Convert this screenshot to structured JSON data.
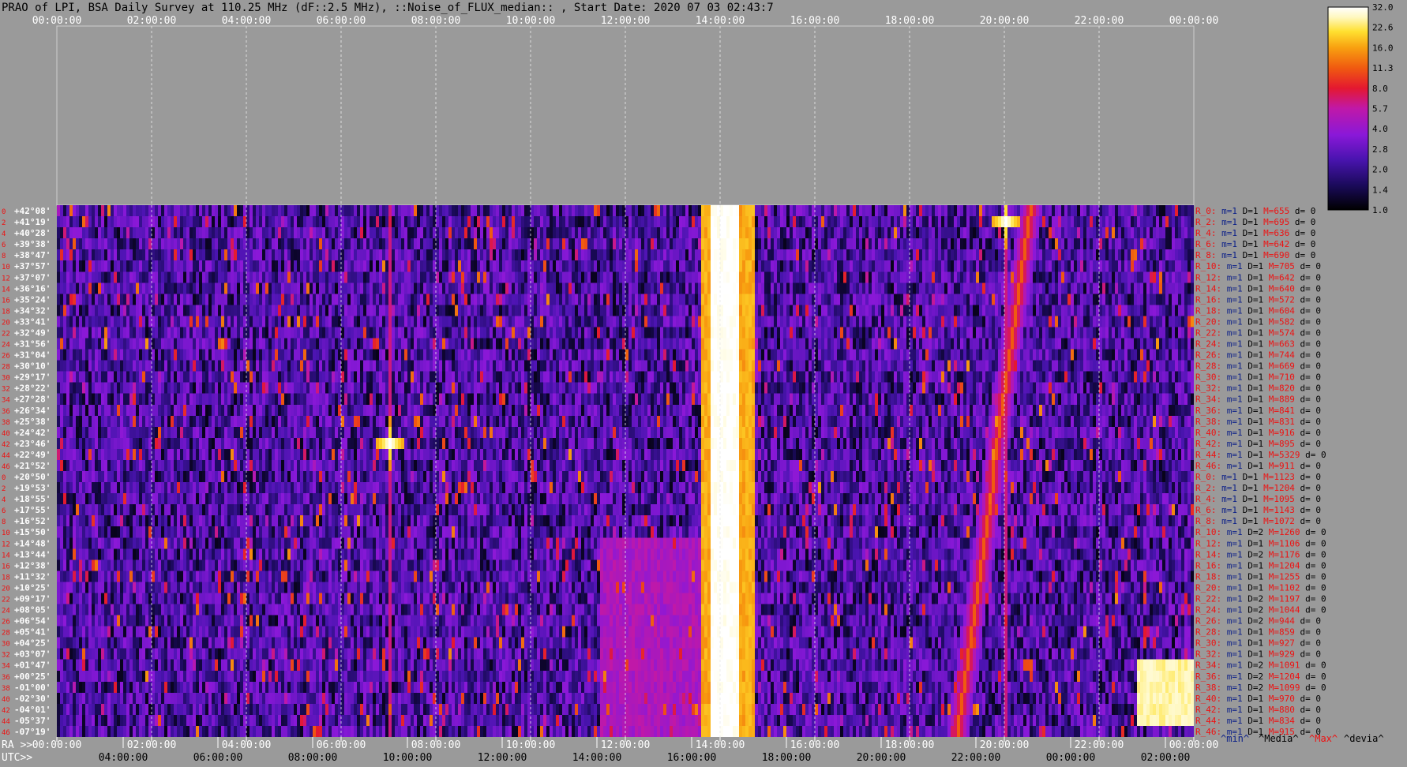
{
  "title": "PRAO of LPI, BSA Daily Survey at 110.25 MHz (dF::2.5 MHz), ::Noise_of_FLUX_median:: , Start Date: 2020 07 03 02:43:7",
  "top_axis_ticks": [
    "00:00:00",
    "02:00:00",
    "04:00:00",
    "06:00:00",
    "08:00:00",
    "10:00:00",
    "12:00:00",
    "14:00:00",
    "16:00:00",
    "18:00:00",
    "20:00:00",
    "22:00:00",
    "00:00:00"
  ],
  "bottom_axis": {
    "ra_label": "RA >>",
    "utc_label": "UTC>>",
    "ra_ticks": [
      "00:00:00",
      "02:00:00",
      "04:00:00",
      "06:00:00",
      "08:00:00",
      "10:00:00",
      "12:00:00",
      "14:00:00",
      "16:00:00",
      "18:00:00",
      "20:00:00",
      "22:00:00",
      "00:00:00"
    ],
    "utc_ticks": [
      "04:00:00",
      "06:00:00",
      "08:00:00",
      "10:00:00",
      "12:00:00",
      "14:00:00",
      "16:00:00",
      "18:00:00",
      "20:00:00",
      "22:00:00",
      "00:00:00",
      "02:00:00"
    ]
  },
  "row_indices": [
    "0",
    "2",
    "4",
    "6",
    "8",
    "10",
    "12",
    "14",
    "16",
    "18",
    "20",
    "22",
    "24",
    "26",
    "28",
    "30",
    "32",
    "34",
    "36",
    "38",
    "40",
    "42",
    "44",
    "46",
    "0",
    "2",
    "4",
    "6",
    "8",
    "10",
    "12",
    "14",
    "16",
    "18",
    "20",
    "22",
    "24",
    "26",
    "28",
    "30",
    "32",
    "34",
    "36",
    "38",
    "40",
    "42",
    "44",
    "46"
  ],
  "declinations": [
    "+42°08'",
    "+41°19'",
    "+40°28'",
    "+39°38'",
    "+38°47'",
    "+37°57'",
    "+37°07'",
    "+36°16'",
    "+35°24'",
    "+34°32'",
    "+33°41'",
    "+32°49'",
    "+31°56'",
    "+31°04'",
    "+30°10'",
    "+29°17'",
    "+28°22'",
    "+27°28'",
    "+26°34'",
    "+25°38'",
    "+24°42'",
    "+23°46'",
    "+22°49'",
    "+21°52'",
    "+20°50'",
    "+19°53'",
    "+18°55'",
    "+17°55'",
    "+16°52'",
    "+15°50'",
    "+14°48'",
    "+13°44'",
    "+12°38'",
    "+11°32'",
    "+10°25'",
    "+09°17'",
    "+08°05'",
    "+06°54'",
    "+05°41'",
    "+04°25'",
    "+03°07'",
    "+01°47'",
    "+00°25'",
    "-01°00'",
    "-02°30'",
    "-04°01'",
    "-05°37'",
    "-07°19'"
  ],
  "stats_rows": [
    {
      "r": "R_0:",
      "m": "m=1",
      "d": "D=1",
      "M": "M=655",
      "dev": "d= 0"
    },
    {
      "r": "R_2:",
      "m": "m=1",
      "d": "D=1",
      "M": "M=695",
      "dev": "d= 0"
    },
    {
      "r": "R_4:",
      "m": "m=1",
      "d": "D=1",
      "M": "M=636",
      "dev": "d= 0"
    },
    {
      "r": "R_6:",
      "m": "m=1",
      "d": "D=1",
      "M": "M=642",
      "dev": "d= 0"
    },
    {
      "r": "R_8:",
      "m": "m=1",
      "d": "D=1",
      "M": "M=690",
      "dev": "d= 0"
    },
    {
      "r": "R_10:",
      "m": "m=1",
      "d": "D=1",
      "M": "M=705",
      "dev": "d= 0"
    },
    {
      "r": "R_12:",
      "m": "m=1",
      "d": "D=1",
      "M": "M=642",
      "dev": "d= 0"
    },
    {
      "r": "R_14:",
      "m": "m=1",
      "d": "D=1",
      "M": "M=640",
      "dev": "d= 0"
    },
    {
      "r": "R_16:",
      "m": "m=1",
      "d": "D=1",
      "M": "M=572",
      "dev": "d= 0"
    },
    {
      "r": "R_18:",
      "m": "m=1",
      "d": "D=1",
      "M": "M=604",
      "dev": "d= 0"
    },
    {
      "r": "R_20:",
      "m": "m=1",
      "d": "D=1",
      "M": "M=582",
      "dev": "d= 0"
    },
    {
      "r": "R_22:",
      "m": "m=1",
      "d": "D=1",
      "M": "M=574",
      "dev": "d= 0"
    },
    {
      "r": "R_24:",
      "m": "m=1",
      "d": "D=1",
      "M": "M=663",
      "dev": "d= 0"
    },
    {
      "r": "R_26:",
      "m": "m=1",
      "d": "D=1",
      "M": "M=744",
      "dev": "d= 0"
    },
    {
      "r": "R_28:",
      "m": "m=1",
      "d": "D=1",
      "M": "M=669",
      "dev": "d= 0"
    },
    {
      "r": "R_30:",
      "m": "m=1",
      "d": "D=1",
      "M": "M=710",
      "dev": "d= 0"
    },
    {
      "r": "R_32:",
      "m": "m=1",
      "d": "D=1",
      "M": "M=820",
      "dev": "d= 0"
    },
    {
      "r": "R_34:",
      "m": "m=1",
      "d": "D=1",
      "M": "M=889",
      "dev": "d= 0"
    },
    {
      "r": "R_36:",
      "m": "m=1",
      "d": "D=1",
      "M": "M=841",
      "dev": "d= 0"
    },
    {
      "r": "R_38:",
      "m": "m=1",
      "d": "D=1",
      "M": "M=831",
      "dev": "d= 0"
    },
    {
      "r": "R_40:",
      "m": "m=1",
      "d": "D=1",
      "M": "M=916",
      "dev": "d= 0"
    },
    {
      "r": "R_42:",
      "m": "m=1",
      "d": "D=1",
      "M": "M=895",
      "dev": "d= 0"
    },
    {
      "r": "R_44:",
      "m": "m=1",
      "d": "D=1",
      "M": "M=5329",
      "dev": "d= 0"
    },
    {
      "r": "R_46:",
      "m": "m=1",
      "d": "D=1",
      "M": "M=911",
      "dev": "d= 0"
    },
    {
      "r": "R_0:",
      "m": "m=1",
      "d": "D=1",
      "M": "M=1123",
      "dev": "d= 0"
    },
    {
      "r": "R_2:",
      "m": "m=1",
      "d": "D=1",
      "M": "M=1204",
      "dev": "d= 0"
    },
    {
      "r": "R_4:",
      "m": "m=1",
      "d": "D=1",
      "M": "M=1095",
      "dev": "d= 0"
    },
    {
      "r": "R_6:",
      "m": "m=1",
      "d": "D=1",
      "M": "M=1143",
      "dev": "d= 0"
    },
    {
      "r": "R_8:",
      "m": "m=1",
      "d": "D=1",
      "M": "M=1072",
      "dev": "d= 0"
    },
    {
      "r": "R_10:",
      "m": "m=1",
      "d": "D=2",
      "M": "M=1260",
      "dev": "d= 0"
    },
    {
      "r": "R_12:",
      "m": "m=1",
      "d": "D=1",
      "M": "M=1106",
      "dev": "d= 0"
    },
    {
      "r": "R_14:",
      "m": "m=1",
      "d": "D=2",
      "M": "M=1176",
      "dev": "d= 0"
    },
    {
      "r": "R_16:",
      "m": "m=1",
      "d": "D=1",
      "M": "M=1204",
      "dev": "d= 0"
    },
    {
      "r": "R_18:",
      "m": "m=1",
      "d": "D=1",
      "M": "M=1255",
      "dev": "d= 0"
    },
    {
      "r": "R_20:",
      "m": "m=1",
      "d": "D=1",
      "M": "M=1102",
      "dev": "d= 0"
    },
    {
      "r": "R_22:",
      "m": "m=1",
      "d": "D=2",
      "M": "M=1197",
      "dev": "d= 0"
    },
    {
      "r": "R_24:",
      "m": "m=1",
      "d": "D=2",
      "M": "M=1044",
      "dev": "d= 0"
    },
    {
      "r": "R_26:",
      "m": "m=1",
      "d": "D=2",
      "M": "M=944",
      "dev": "d= 0"
    },
    {
      "r": "R_28:",
      "m": "m=1",
      "d": "D=1",
      "M": "M=859",
      "dev": "d= 0"
    },
    {
      "r": "R_30:",
      "m": "m=1",
      "d": "D=1",
      "M": "M=927",
      "dev": "d= 0"
    },
    {
      "r": "R_32:",
      "m": "m=1",
      "d": "D=1",
      "M": "M=929",
      "dev": "d= 0"
    },
    {
      "r": "R_34:",
      "m": "m=1",
      "d": "D=2",
      "M": "M=1091",
      "dev": "d= 0"
    },
    {
      "r": "R_36:",
      "m": "m=1",
      "d": "D=2",
      "M": "M=1204",
      "dev": "d= 0"
    },
    {
      "r": "R_38:",
      "m": "m=1",
      "d": "D=2",
      "M": "M=1099",
      "dev": "d= 0"
    },
    {
      "r": "R_40:",
      "m": "m=1",
      "d": "D=1",
      "M": "M=970",
      "dev": "d= 0"
    },
    {
      "r": "R_42:",
      "m": "m=1",
      "d": "D=1",
      "M": "M=880",
      "dev": "d= 0"
    },
    {
      "r": "R_44:",
      "m": "m=1",
      "d": "D=1",
      "M": "M=834",
      "dev": "d= 0"
    },
    {
      "r": "R_46:",
      "m": "m=1",
      "d": "D=1",
      "M": "M=915",
      "dev": "d= 0"
    }
  ],
  "stats_legend": {
    "min": "^min^",
    "median": "^Media^",
    "max": "^Max^",
    "devia": "^devia^"
  },
  "colors": {
    "background": "#9a9a9a",
    "plot_bg": "#0a0630",
    "red_text": "#ee1111",
    "blue_text": "#0b1f88",
    "black_text": "#000000",
    "white_text": "#ffffff",
    "colormap": [
      "#000000",
      "#1a0a5a",
      "#4a14b0",
      "#8a18d8",
      "#c018a8",
      "#e41830",
      "#f05a10",
      "#f8a010",
      "#ffe030",
      "#fff8c0",
      "#ffffff"
    ]
  },
  "colorbar": {
    "ticks": [
      "32.0",
      "22.6",
      "16.0",
      "11.3",
      "8.0",
      "5.7",
      "4.0",
      "2.8",
      "2.0",
      "1.4",
      "1.0"
    ]
  },
  "chart_data": {
    "type": "heatmap",
    "title": "PRAO of LPI, BSA Daily Survey at 110.25 MHz (dF::2.5 MHz), ::Noise_of_FLUX_median:: , Start Date: 2020 07 03 02:43:7",
    "x_axis": "RA 00:00:00 – 24:00:00 (UTC 04:00 – 04:00 next day)",
    "y_axis": "Declination, +42°08' to -07°19' (48 beams)",
    "color_scale": {
      "min": 1.0,
      "max": 32.0,
      "scale": "log",
      "ticks": [
        1.0,
        1.4,
        2.0,
        2.8,
        4.0,
        5.7,
        8.0,
        11.3,
        16.0,
        22.6,
        32.0
      ]
    },
    "background_level": 2.0,
    "features": [
      {
        "kind": "saturated_vertical_band",
        "ra_hours": [
          13.8,
          14.3
        ],
        "value": 32
      },
      {
        "kind": "bright_vertical_lines",
        "ra_hours": [
          13.7,
          14.5,
          14.6
        ],
        "value": 12
      },
      {
        "kind": "point_source",
        "ra_hours": 7.0,
        "dec_index": 21,
        "value": 32
      },
      {
        "kind": "point_source",
        "ra_hours": 20.0,
        "dec_index": 1,
        "value": 32
      },
      {
        "kind": "drifting_band",
        "ra_start": 20.5,
        "ra_end": 19.0,
        "value": 8
      },
      {
        "kind": "bright_patch",
        "ra_hours": [
          22.8,
          24.0
        ],
        "dec_rows": [
          41,
          46
        ],
        "value": 22
      },
      {
        "kind": "diffuse_glow",
        "ra_hours": [
          11.5,
          14.0
        ],
        "value": 5
      }
    ]
  }
}
